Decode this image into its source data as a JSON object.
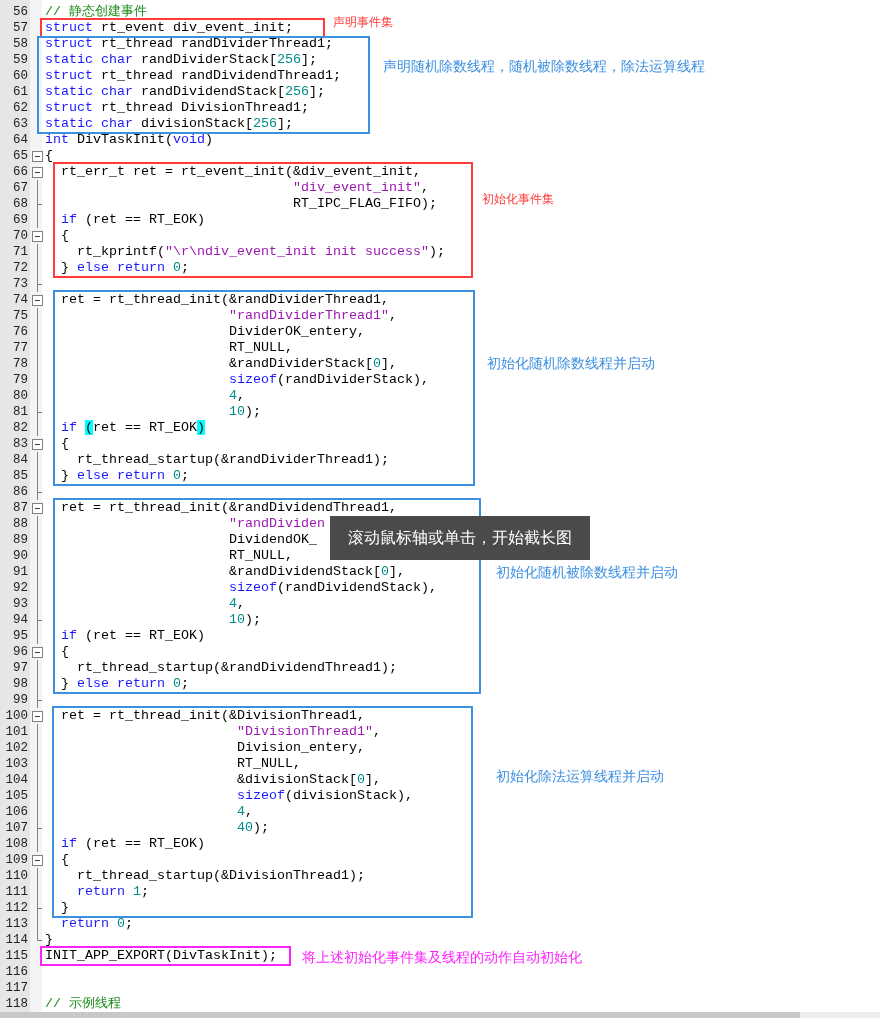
{
  "editor": {
    "lines": [
      {
        "number": "56",
        "kind": "plain",
        "tokens": [
          {
            "kind": "comment",
            "text": "// 静态创建事件"
          }
        ]
      },
      {
        "number": "57",
        "kind": "plain",
        "tokens": [
          {
            "kind": "keyword",
            "text": "struct"
          },
          {
            "kind": "plain",
            "text": " rt_event div_event_init;"
          }
        ]
      },
      {
        "number": "58",
        "kind": "plain",
        "tokens": [
          {
            "kind": "keyword",
            "text": "struct"
          },
          {
            "kind": "plain",
            "text": " rt_thread randDividerThread1;"
          }
        ]
      },
      {
        "number": "59",
        "kind": "plain",
        "tokens": [
          {
            "kind": "keyword",
            "text": "static char"
          },
          {
            "kind": "plain",
            "text": " randDividerStack["
          },
          {
            "kind": "number",
            "text": "256"
          },
          {
            "kind": "plain",
            "text": "];"
          }
        ]
      },
      {
        "number": "60",
        "kind": "plain",
        "tokens": [
          {
            "kind": "keyword",
            "text": "struct"
          },
          {
            "kind": "plain",
            "text": " rt_thread randDividendThread1;"
          }
        ]
      },
      {
        "number": "61",
        "kind": "plain",
        "tokens": [
          {
            "kind": "keyword",
            "text": "static char"
          },
          {
            "kind": "plain",
            "text": " randDividendStack["
          },
          {
            "kind": "number",
            "text": "256"
          },
          {
            "kind": "plain",
            "text": "];"
          }
        ]
      },
      {
        "number": "62",
        "kind": "plain",
        "tokens": [
          {
            "kind": "keyword",
            "text": "struct"
          },
          {
            "kind": "plain",
            "text": " rt_thread DivisionThread1;"
          }
        ]
      },
      {
        "number": "63",
        "kind": "plain",
        "tokens": [
          {
            "kind": "keyword",
            "text": "static char"
          },
          {
            "kind": "plain",
            "text": " divisionStack["
          },
          {
            "kind": "number",
            "text": "256"
          },
          {
            "kind": "plain",
            "text": "];"
          }
        ]
      },
      {
        "number": "64",
        "kind": "plain",
        "tokens": [
          {
            "kind": "keyword",
            "text": "int"
          },
          {
            "kind": "plain",
            "text": " DivTaskInit("
          },
          {
            "kind": "keyword",
            "text": "void"
          },
          {
            "kind": "plain",
            "text": ")"
          }
        ]
      },
      {
        "number": "65",
        "kind": "fold_start",
        "tokens": [
          {
            "kind": "plain",
            "text": "{"
          }
        ]
      },
      {
        "number": "66",
        "kind": "fold_start",
        "tokens": [
          {
            "kind": "plain",
            "text": "  rt_err_t ret = rt_event_init(&div_event_init,"
          }
        ]
      },
      {
        "number": "67",
        "kind": "fold_body",
        "tokens": [
          {
            "kind": "string",
            "text": "                               \"div_event_init\""
          },
          {
            "kind": "plain",
            "text": ","
          }
        ]
      },
      {
        "number": "68",
        "kind": "fold_tick",
        "tokens": [
          {
            "kind": "plain",
            "text": "                               RT_IPC_FLAG_FIFO);"
          }
        ]
      },
      {
        "number": "69",
        "kind": "fold_body",
        "tokens": [
          {
            "kind": "keyword",
            "text": "  if"
          },
          {
            "kind": "plain",
            "text": " (ret == RT_EOK)"
          }
        ]
      },
      {
        "number": "70",
        "kind": "fold_start",
        "tokens": [
          {
            "kind": "plain",
            "text": "  {"
          }
        ]
      },
      {
        "number": "71",
        "kind": "fold_body",
        "tokens": [
          {
            "kind": "plain",
            "text": "    rt_kprintf("
          },
          {
            "kind": "string",
            "text": "\"\\r\\ndiv_event_init init success\""
          },
          {
            "kind": "plain",
            "text": ");"
          }
        ]
      },
      {
        "number": "72",
        "kind": "fold_body",
        "tokens": [
          {
            "kind": "plain",
            "text": "  } "
          },
          {
            "kind": "keyword",
            "text": "else return"
          },
          {
            "kind": "number",
            "text": " 0"
          },
          {
            "kind": "plain",
            "text": ";"
          }
        ]
      },
      {
        "number": "73",
        "kind": "fold_tick"
      },
      {
        "number": "74",
        "kind": "fold_start",
        "tokens": [
          {
            "kind": "plain",
            "text": "  ret = rt_thread_init(&randDividerThread1,"
          }
        ]
      },
      {
        "number": "75",
        "kind": "fold_body",
        "tokens": [
          {
            "kind": "string",
            "text": "                       \"randDividerThread1\""
          },
          {
            "kind": "plain",
            "text": ","
          }
        ]
      },
      {
        "number": "76",
        "kind": "fold_body",
        "tokens": [
          {
            "kind": "plain",
            "text": "                       DividerOK_entery,"
          }
        ]
      },
      {
        "number": "77",
        "kind": "fold_body",
        "tokens": [
          {
            "kind": "plain",
            "text": "                       RT_NULL,"
          }
        ]
      },
      {
        "number": "78",
        "kind": "fold_body",
        "tokens": [
          {
            "kind": "plain",
            "text": "                       &randDividerStack["
          },
          {
            "kind": "number",
            "text": "0"
          },
          {
            "kind": "plain",
            "text": "],"
          }
        ]
      },
      {
        "number": "79",
        "kind": "fold_body",
        "tokens": [
          {
            "kind": "keyword",
            "text": "                       sizeof"
          },
          {
            "kind": "plain",
            "text": "(randDividerStack),"
          }
        ]
      },
      {
        "number": "80",
        "kind": "fold_body",
        "tokens": [
          {
            "kind": "number",
            "text": "                       4"
          },
          {
            "kind": "plain",
            "text": ","
          }
        ]
      },
      {
        "number": "81",
        "kind": "fold_tick",
        "tokens": [
          {
            "kind": "number",
            "text": "                       10"
          },
          {
            "kind": "plain",
            "text": ");"
          }
        ]
      },
      {
        "number": "82",
        "kind": "fold_body",
        "tokens": [
          {
            "kind": "keyword",
            "text": "  if "
          },
          {
            "kind": "brace_match",
            "text": "("
          },
          {
            "kind": "plain",
            "text": "ret == RT_EOK"
          },
          {
            "kind": "brace_match",
            "text": ")"
          }
        ]
      },
      {
        "number": "83",
        "kind": "fold_start",
        "tokens": [
          {
            "kind": "plain",
            "text": "  {"
          }
        ]
      },
      {
        "number": "84",
        "kind": "fold_body",
        "tokens": [
          {
            "kind": "plain",
            "text": "    rt_thread_startup(&randDividerThread1);"
          }
        ]
      },
      {
        "number": "85",
        "kind": "fold_body",
        "tokens": [
          {
            "kind": "plain",
            "text": "  } "
          },
          {
            "kind": "keyword",
            "text": "else return"
          },
          {
            "kind": "number",
            "text": " 0"
          },
          {
            "kind": "plain",
            "text": ";"
          }
        ]
      },
      {
        "number": "86",
        "kind": "fold_tick"
      },
      {
        "number": "87",
        "kind": "fold_start",
        "tokens": [
          {
            "kind": "plain",
            "text": "  ret = rt_thread_init(&randDividendThread1,"
          }
        ]
      },
      {
        "number": "88",
        "kind": "fold_body",
        "tokens": [
          {
            "kind": "string",
            "text": "                       \"randDividen"
          }
        ]
      },
      {
        "number": "89",
        "kind": "fold_body",
        "tokens": [
          {
            "kind": "plain",
            "text": "                       DividendOK_"
          }
        ]
      },
      {
        "number": "90",
        "kind": "fold_body",
        "tokens": [
          {
            "kind": "plain",
            "text": "                       RT_NULL,"
          }
        ]
      },
      {
        "number": "91",
        "kind": "fold_body",
        "tokens": [
          {
            "kind": "plain",
            "text": "                       &randDividendStack["
          },
          {
            "kind": "number",
            "text": "0"
          },
          {
            "kind": "plain",
            "text": "],"
          }
        ]
      },
      {
        "number": "92",
        "kind": "fold_body",
        "tokens": [
          {
            "kind": "keyword",
            "text": "                       sizeof"
          },
          {
            "kind": "plain",
            "text": "(randDividendStack),"
          }
        ]
      },
      {
        "number": "93",
        "kind": "fold_body",
        "tokens": [
          {
            "kind": "number",
            "text": "                       4"
          },
          {
            "kind": "plain",
            "text": ","
          }
        ]
      },
      {
        "number": "94",
        "kind": "fold_tick",
        "tokens": [
          {
            "kind": "number",
            "text": "                       10"
          },
          {
            "kind": "plain",
            "text": ");"
          }
        ]
      },
      {
        "number": "95",
        "kind": "fold_body",
        "tokens": [
          {
            "kind": "keyword",
            "text": "  if"
          },
          {
            "kind": "plain",
            "text": " (ret == RT_EOK)"
          }
        ]
      },
      {
        "number": "96",
        "kind": "fold_start",
        "tokens": [
          {
            "kind": "plain",
            "text": "  {"
          }
        ]
      },
      {
        "number": "97",
        "kind": "fold_body",
        "tokens": [
          {
            "kind": "plain",
            "text": "    rt_thread_startup(&randDividendThread1);"
          }
        ]
      },
      {
        "number": "98",
        "kind": "fold_body",
        "tokens": [
          {
            "kind": "plain",
            "text": "  } "
          },
          {
            "kind": "keyword",
            "text": "else return"
          },
          {
            "kind": "number",
            "text": " 0"
          },
          {
            "kind": "plain",
            "text": ";"
          }
        ]
      },
      {
        "number": "99",
        "kind": "fold_tick"
      },
      {
        "number": "100",
        "kind": "fold_start",
        "tokens": [
          {
            "kind": "plain",
            "text": "  ret = rt_thread_init(&DivisionThread1,"
          }
        ]
      },
      {
        "number": "101",
        "kind": "fold_body",
        "tokens": [
          {
            "kind": "string",
            "text": "                        \"DivisionThread1\""
          },
          {
            "kind": "plain",
            "text": ","
          }
        ]
      },
      {
        "number": "102",
        "kind": "fold_body",
        "tokens": [
          {
            "kind": "plain",
            "text": "                        Division_entery,"
          }
        ]
      },
      {
        "number": "103",
        "kind": "fold_body",
        "tokens": [
          {
            "kind": "plain",
            "text": "                        RT_NULL,"
          }
        ]
      },
      {
        "number": "104",
        "kind": "fold_body",
        "tokens": [
          {
            "kind": "plain",
            "text": "                        &divisionStack["
          },
          {
            "kind": "number",
            "text": "0"
          },
          {
            "kind": "plain",
            "text": "],"
          }
        ]
      },
      {
        "number": "105",
        "kind": "fold_body",
        "tokens": [
          {
            "kind": "keyword",
            "text": "                        sizeof"
          },
          {
            "kind": "plain",
            "text": "(divisionStack),"
          }
        ]
      },
      {
        "number": "106",
        "kind": "fold_body",
        "tokens": [
          {
            "kind": "number",
            "text": "                        4"
          },
          {
            "kind": "plain",
            "text": ","
          }
        ]
      },
      {
        "number": "107",
        "kind": "fold_tick",
        "tokens": [
          {
            "kind": "number",
            "text": "                        40"
          },
          {
            "kind": "plain",
            "text": ");"
          }
        ]
      },
      {
        "number": "108",
        "kind": "fold_body",
        "tokens": [
          {
            "kind": "keyword",
            "text": "  if"
          },
          {
            "kind": "plain",
            "text": " (ret == RT_EOK)"
          }
        ]
      },
      {
        "number": "109",
        "kind": "fold_start",
        "tokens": [
          {
            "kind": "plain",
            "text": "  {"
          }
        ]
      },
      {
        "number": "110",
        "kind": "fold_body",
        "tokens": [
          {
            "kind": "plain",
            "text": "    rt_thread_startup(&DivisionThread1);"
          }
        ]
      },
      {
        "number": "111",
        "kind": "fold_body",
        "tokens": [
          {
            "kind": "keyword",
            "text": "    return"
          },
          {
            "kind": "number",
            "text": " 1"
          },
          {
            "kind": "plain",
            "text": ";"
          }
        ]
      },
      {
        "number": "112",
        "kind": "fold_tick",
        "tokens": [
          {
            "kind": "plain",
            "text": "  }"
          }
        ]
      },
      {
        "number": "113",
        "kind": "fold_body",
        "tokens": [
          {
            "kind": "keyword",
            "text": "  return"
          },
          {
            "kind": "number",
            "text": " 0"
          },
          {
            "kind": "plain",
            "text": ";"
          }
        ]
      },
      {
        "number": "114",
        "kind": "fold_end",
        "tokens": [
          {
            "kind": "plain",
            "text": "}"
          }
        ]
      },
      {
        "number": "115",
        "kind": "plain",
        "tokens": [
          {
            "kind": "plain",
            "text": "INIT_APP_EXPORT(DivTaskInit);"
          }
        ]
      },
      {
        "number": "116",
        "kind": "plain"
      },
      {
        "number": "117",
        "kind": "plain"
      },
      {
        "number": "118",
        "kind": "plain",
        "tokens": [
          {
            "kind": "comment",
            "text": "// 示例线程"
          }
        ]
      }
    ]
  },
  "annotations": [
    {
      "color": "#ff3b3b",
      "label": "声明事件集"
    },
    {
      "color": "#3d8fe0",
      "label": "声明随机除数线程，随机被除数线程，除法运算线程"
    },
    {
      "color": "#ff3b3b",
      "label": "初始化事件集"
    },
    {
      "color": "#3d8fe0",
      "label": "初始化随机除数线程并启动"
    },
    {
      "color": "#3d8fe0",
      "label": "初始化随机被除数线程并启动"
    },
    {
      "color": "#3d8fe0",
      "label": "初始化除法运算线程并启动"
    },
    {
      "color": "#ff22ff",
      "label": "将上述初始化事件集及线程的动作自动初始化"
    }
  ],
  "toast": {
    "text": "滚动鼠标轴或单击，开始截长图"
  }
}
